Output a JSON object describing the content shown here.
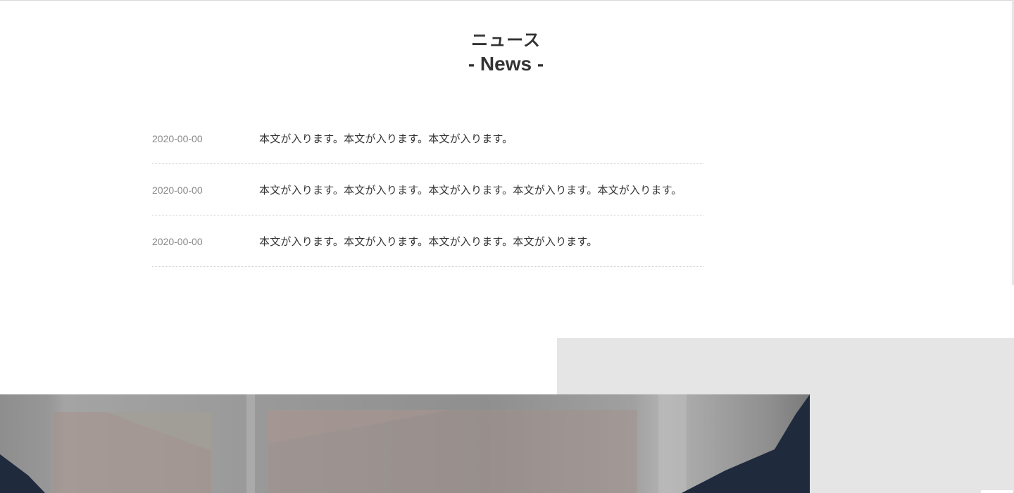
{
  "section": {
    "title_ja": "ニュース",
    "title_en": "- News -"
  },
  "news": [
    {
      "date": "2020-00-00",
      "text": "本文が入ります。本文が入ります。本文が入ります。"
    },
    {
      "date": "2020-00-00",
      "text": "本文が入ります。本文が入ります。本文が入ります。本文が入ります。本文が入ります。"
    },
    {
      "date": "2020-00-00",
      "text": "本文が入ります。本文が入ります。本文が入ります。本文が入ります。"
    }
  ],
  "colors": {
    "text": "#333333",
    "date": "#888888",
    "divider": "#d0d0d0",
    "gray_panel": "#e5e5e5",
    "jacket": "#1f2a3d"
  }
}
